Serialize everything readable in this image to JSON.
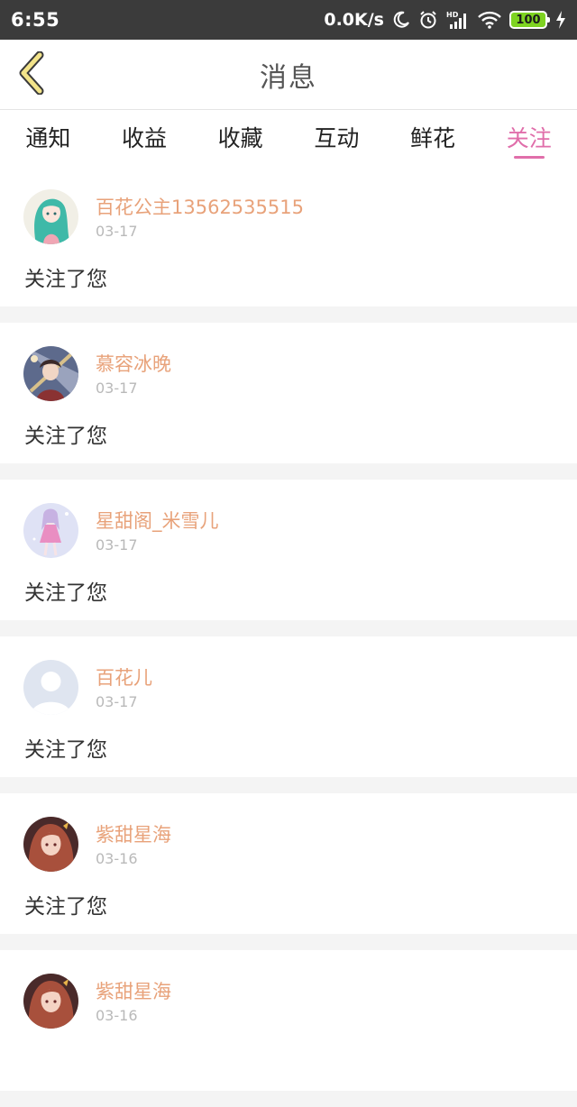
{
  "status_bar": {
    "time": "6:55",
    "net_speed": "0.0K/s",
    "battery": "100",
    "icons": [
      "moon-icon",
      "alarm-icon",
      "hd-signal-icon",
      "wifi-icon",
      "battery-icon",
      "charging-icon"
    ]
  },
  "header": {
    "title": "消息",
    "back_icon": "chevron-left-icon"
  },
  "tabs": [
    {
      "label": "通知",
      "active": false
    },
    {
      "label": "收益",
      "active": false
    },
    {
      "label": "收藏",
      "active": false
    },
    {
      "label": "互动",
      "active": false
    },
    {
      "label": "鲜花",
      "active": false
    },
    {
      "label": "关注",
      "active": true
    }
  ],
  "colors": {
    "accent": "#e06eaa",
    "username": "#e8a27a",
    "back_icon": "#c9b84a",
    "status_bar": "#3b3b3b"
  },
  "notifications": [
    {
      "username": "百花公主13562535515",
      "date": "03-17",
      "message": "关注了您",
      "avatar": "anime-girl-teal-hair-avatar"
    },
    {
      "username": "慕容冰晚",
      "date": "03-17",
      "message": "关注了您",
      "avatar": "anime-warrior-avatar"
    },
    {
      "username": "星甜阁_米雪儿",
      "date": "03-17",
      "message": "关注了您",
      "avatar": "anime-girl-lavender-avatar"
    },
    {
      "username": "百花儿",
      "date": "03-17",
      "message": "关注了您",
      "avatar": "default-user-avatar"
    },
    {
      "username": "紫甜星海",
      "date": "03-16",
      "message": "关注了您",
      "avatar": "anime-girl-red-hair-avatar"
    },
    {
      "username": "紫甜星海",
      "date": "03-16",
      "message": "",
      "avatar": "anime-girl-red-hair-avatar"
    }
  ]
}
